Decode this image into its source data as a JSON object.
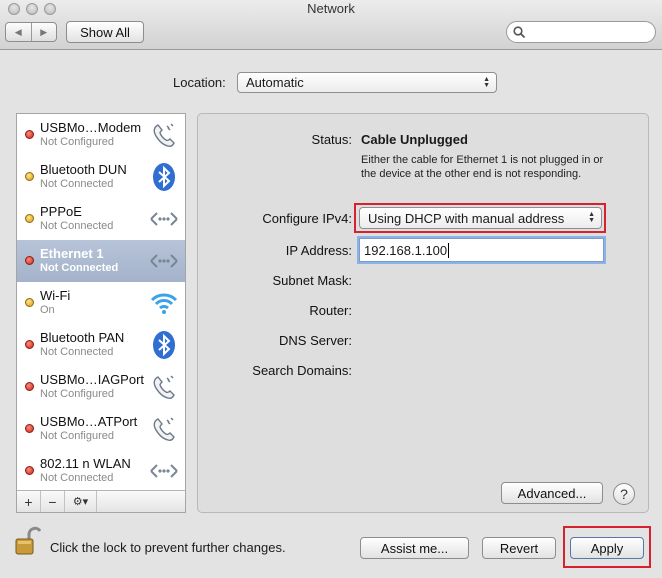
{
  "window": {
    "title": "Network",
    "show_all": "Show All",
    "search_placeholder": ""
  },
  "location": {
    "label": "Location:",
    "value": "Automatic"
  },
  "services": [
    {
      "name": "USBMo…Modem",
      "status": "Not Configured",
      "dot": "red",
      "icon": "phone-icon",
      "selected": false
    },
    {
      "name": "Bluetooth DUN",
      "status": "Not Connected",
      "dot": "yellow",
      "icon": "bluetooth-icon",
      "selected": false
    },
    {
      "name": "PPPoE",
      "status": "Not Connected",
      "dot": "yellow",
      "icon": "ethernet-arrows-icon",
      "selected": false
    },
    {
      "name": "Ethernet 1",
      "status": "Not Connected",
      "dot": "red",
      "icon": "ethernet-arrows-icon",
      "selected": true
    },
    {
      "name": "Wi-Fi",
      "status": "On",
      "dot": "yellow",
      "icon": "wifi-icon",
      "selected": false
    },
    {
      "name": "Bluetooth PAN",
      "status": "Not Connected",
      "dot": "red",
      "icon": "bluetooth-icon",
      "selected": false
    },
    {
      "name": "USBMo…IAGPort",
      "status": "Not Configured",
      "dot": "red",
      "icon": "phone-icon",
      "selected": false
    },
    {
      "name": "USBMo…ATPort",
      "status": "Not Configured",
      "dot": "red",
      "icon": "phone-icon",
      "selected": false
    },
    {
      "name": "802.11 n WLAN",
      "status": "Not Connected",
      "dot": "red",
      "icon": "ethernet-arrows-icon",
      "selected": false
    }
  ],
  "sidebar_footer": {
    "add": "+",
    "remove": "−",
    "gear": "⚙▾"
  },
  "detail": {
    "status_label": "Status:",
    "status_value": "Cable Unplugged",
    "status_description": "Either the cable for Ethernet 1 is not plugged in or the device at the other end is not responding.",
    "configure_label": "Configure IPv4:",
    "configure_value": "Using DHCP with manual address",
    "ip_label": "IP Address:",
    "ip_value": "192.168.1.100",
    "subnet_label": "Subnet Mask:",
    "router_label": "Router:",
    "dns_label": "DNS Server:",
    "search_domains_label": "Search Domains:",
    "advanced_button": "Advanced...",
    "help_button": "?"
  },
  "footer": {
    "lock_text": "Click the lock to prevent further changes.",
    "assist_button": "Assist me...",
    "revert_button": "Revert",
    "apply_button": "Apply"
  },
  "colors": {
    "highlight": "#d6212f",
    "selected_row": "#a4b3cb",
    "status_red": "#c8271a",
    "status_yellow": "#d69b12",
    "bluetooth": "#2f6fd1"
  }
}
